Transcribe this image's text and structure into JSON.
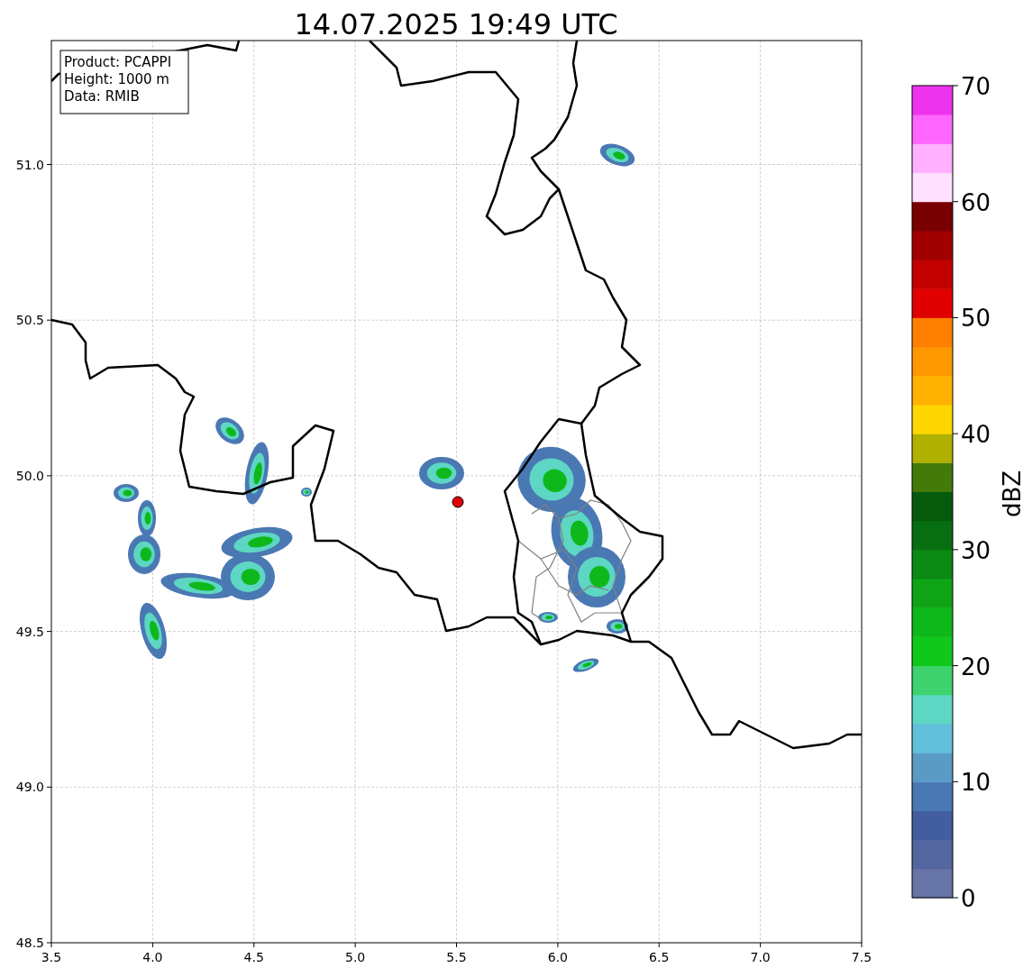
{
  "title": "14.07.2025 19:49 UTC",
  "info_box": {
    "lines": [
      "Product: PCAPPI",
      "Height: 1000 m",
      "Data: RMIB"
    ]
  },
  "x_axis": {
    "ticks": [
      "3.5",
      "4.0",
      "4.5",
      "5.0",
      "5.5",
      "6.0",
      "6.5",
      "7.0",
      "7.5"
    ]
  },
  "y_axis": {
    "ticks": [
      "51.0",
      "50.5",
      "50.0",
      "49.5",
      "49.0",
      "48.5"
    ]
  },
  "colorbar": {
    "label": "dBZ",
    "ticks": [
      "70",
      "60",
      "50",
      "40",
      "30",
      "20",
      "10",
      "0"
    ],
    "bins": [
      {
        "color": "#6674a6"
      },
      {
        "color": "#5466a0"
      },
      {
        "color": "#425da0"
      },
      {
        "color": "#4a78b3"
      },
      {
        "color": "#5a9bc6"
      },
      {
        "color": "#63c0dc"
      },
      {
        "color": "#5dd6c4"
      },
      {
        "color": "#3ed36e"
      },
      {
        "color": "#10c81b"
      },
      {
        "color": "#0fb81a"
      },
      {
        "color": "#0ea416"
      },
      {
        "color": "#0b8a14"
      },
      {
        "color": "#086e12"
      },
      {
        "color": "#055a0c"
      },
      {
        "color": "#447a0a"
      },
      {
        "color": "#b0b000"
      },
      {
        "color": "#ffd700"
      },
      {
        "color": "#ffb300"
      },
      {
        "color": "#ff9800"
      },
      {
        "color": "#ff7f00"
      },
      {
        "color": "#e00000"
      },
      {
        "color": "#c20000"
      },
      {
        "color": "#a00000"
      },
      {
        "color": "#780000"
      },
      {
        "color": "#ffe0ff"
      },
      {
        "color": "#ffb0ff"
      },
      {
        "color": "#ff66ff"
      },
      {
        "color": "#ee33ee"
      }
    ]
  }
}
